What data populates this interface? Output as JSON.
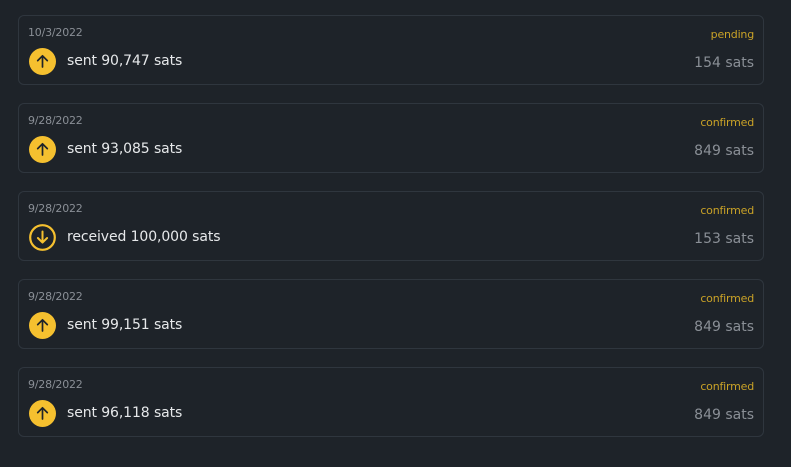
{
  "colors": {
    "background": "#1e2329",
    "card_border": "#2f363e",
    "accent": "#f5c02f",
    "status": "#c9a227",
    "muted_text": "#8a8f96",
    "primary_text": "#e6e8ea"
  },
  "transactions": [
    {
      "date": "10/3/2022",
      "status": "pending",
      "direction": "sent",
      "icon": "arrow-up-icon",
      "description": "sent 90,747 sats",
      "fee": "154 sats"
    },
    {
      "date": "9/28/2022",
      "status": "confirmed",
      "direction": "sent",
      "icon": "arrow-up-icon",
      "description": "sent 93,085 sats",
      "fee": "849 sats"
    },
    {
      "date": "9/28/2022",
      "status": "confirmed",
      "direction": "received",
      "icon": "arrow-down-icon",
      "description": "received 100,000 sats",
      "fee": "153 sats"
    },
    {
      "date": "9/28/2022",
      "status": "confirmed",
      "direction": "sent",
      "icon": "arrow-up-icon",
      "description": "sent 99,151 sats",
      "fee": "849 sats"
    },
    {
      "date": "9/28/2022",
      "status": "confirmed",
      "direction": "sent",
      "icon": "arrow-up-icon",
      "description": "sent 96,118 sats",
      "fee": "849 sats"
    }
  ]
}
